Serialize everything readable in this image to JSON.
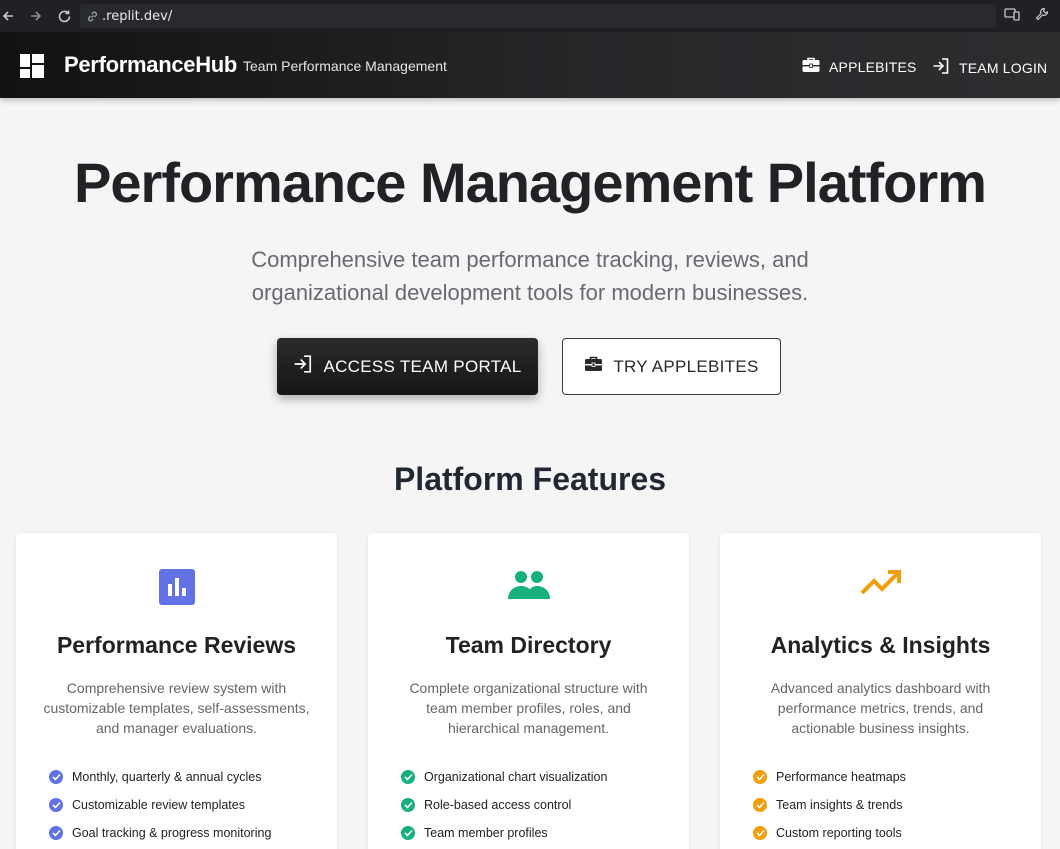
{
  "browser": {
    "url": ".replit.dev/"
  },
  "header": {
    "brand": "PerformanceHub",
    "tagline": "Team Performance Management",
    "nav": [
      {
        "label": "APPLEBITES",
        "icon": "briefcase-icon"
      },
      {
        "label": "TEAM LOGIN",
        "icon": "login-icon"
      }
    ]
  },
  "hero": {
    "title": "Performance Management Platform",
    "subtitle_line1": "Comprehensive team performance tracking, reviews, and",
    "subtitle_line2": "organizational development tools for modern businesses.",
    "primary_button": "ACCESS TEAM PORTAL",
    "secondary_button": "TRY APPLEBITES"
  },
  "features": {
    "title": "Platform Features",
    "cards": [
      {
        "title": "Performance Reviews",
        "description": "Comprehensive review system with customizable templates, self-assessments, and manager evaluations.",
        "icon": "bar-chart-icon",
        "color": "#6272e4",
        "items": [
          "Monthly, quarterly & annual cycles",
          "Customizable review templates",
          "Goal tracking & progress monitoring"
        ]
      },
      {
        "title": "Team Directory",
        "description": "Complete organizational structure with team member profiles, roles, and hierarchical management.",
        "icon": "people-icon",
        "color": "#16b17b",
        "items": [
          "Organizational chart visualization",
          "Role-based access control",
          "Team member profiles"
        ]
      },
      {
        "title": "Analytics & Insights",
        "description": "Advanced analytics dashboard with performance metrics, trends, and actionable business insights.",
        "icon": "trending-up-icon",
        "color": "#f29e0c",
        "items": [
          "Performance heatmaps",
          "Team insights & trends",
          "Custom reporting tools"
        ]
      }
    ]
  }
}
